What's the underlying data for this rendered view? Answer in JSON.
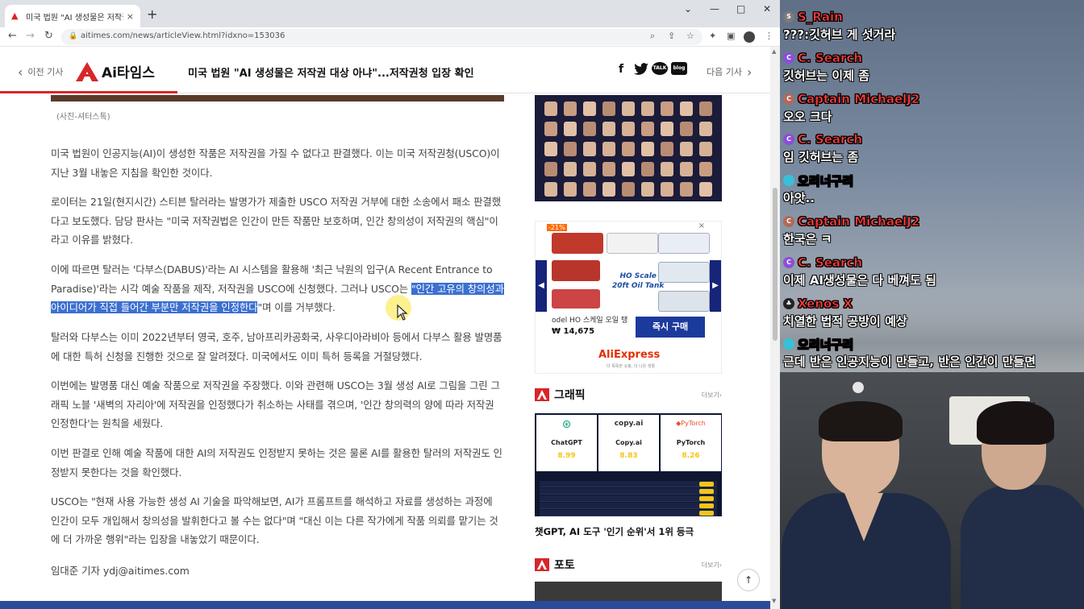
{
  "browser": {
    "tab_title": "미국 법원 \"AI 생성물은 저작권 대상 아니\"...",
    "tab_close": "×",
    "new_tab": "+",
    "url": "aitimes.com/news/articleView.html?idxno=153036",
    "window_controls": {
      "chevron": "⌄",
      "minimize": "—",
      "maximize": "□",
      "close": "✕"
    }
  },
  "site": {
    "prev_label": "이전 기사",
    "logo_text": "Ai타임스",
    "headline": "미국 법원 \"AI 생성물은 저작권 대상 아냐\"...저작권청 입장 확인",
    "social": [
      "f",
      "🐦",
      "TALK",
      "blog"
    ],
    "next_label": "다음 기사"
  },
  "article": {
    "caption": "(사진-셔터스톡)",
    "paragraphs": [
      {
        "text": "미국 법원이 인공지능(AI)이 생성한 작품은 저작권을 가질 수 없다고 판결했다. 이는 미국 저작권청(USCO)이 지난 3월 내놓은 지침을 확인한 것이다."
      },
      {
        "text": "로이터는 21일(현지시간) 스티븐 탈러라는 발명가가 제출한 USCO 저작권 거부에 대한 소송에서 패소 판결했다고 보도했다. 담당 판사는 \"미국 저작권법은 인간이 만든 작품만 보호하며, 인간 창의성이 저작권의 핵심\"이라고 이유를 밝혔다."
      },
      {
        "before": "이에 따르면 탈러는 '다부스(DABUS)'라는 AI 시스템을 활용해 '최근 낙원의 입구(A Recent Entrance to Paradise)'라는 시각 예술 작품을 제작, 저작권을 USCO에 신청했다. 그러나 USCO는 ",
        "highlight": "\"인간 고유의 창의성과 아이디어가 직접 들어간 부분만 저작권을 인정한다",
        "after": "\"며 이를 거부했다."
      },
      {
        "text": "탈러와 다부스는 이미 2022년부터 영국, 호주, 남아프리카공화국, 사우디아라비아 등에서 다부스 활용 발명품에 대한 특허 신청을 진행한 것으로 잘 알려졌다. 미국에서도 이미 특허 등록을 거절당했다."
      },
      {
        "text": "이번에는 발명품 대신 예술 작품으로 저작권을 주장했다. 이와 관련해 USCO는 3월 생성 AI로 그림을 그린 그래픽 노블 '새벽의 자리아'에 저작권을 인정했다가 취소하는 사태를 겪으며, '인간 창의력의 양에 따라 저작권 인정한다'는 원칙을 세웠다."
      },
      {
        "text": "이번 판결로 인해 예술 작품에 대한 AI의 저작권도 인정받지 못하는 것은 물론 AI를 활용한 탈러의 저작권도 인정받지 못한다는 것을 확인했다."
      },
      {
        "text": "USCO는 \"현재 사용 가능한 생성 AI 기술을 파악해보면, AI가 프롬프트를 해석하고 자료를 생성하는 과정에 인간이 모두 개입해서 창의성을 발휘한다고 볼 수는 없다\"며 \"대신 이는 다른 작가에게 작품 의뢰를 맡기는 것에 더 가까운 행위\"라는 입장을 내놓았기 때문이다."
      }
    ],
    "byline": "임대준 기자 ydj@aitimes.com"
  },
  "sidebar": {
    "ad": {
      "sale": "-21%",
      "scale_line1": "HO Scale",
      "scale_line2": "20ft Oil Tank",
      "product": "odel HO 스케일 오일 탱",
      "price": "₩ 14,675",
      "buy": "즉시 구매",
      "brand": "AliExpress",
      "brand_sub": "더 똑똑한 쇼핑, 더 나은 생활",
      "close": "×"
    },
    "graphic": {
      "title": "그래픽",
      "more": "더보기›",
      "cards": [
        {
          "logo": "⊛",
          "name": "ChatGPT",
          "score": "8.99"
        },
        {
          "logo": "copy.ai",
          "name": "Copy.ai",
          "score": "8.83"
        },
        {
          "logo": "◆PyTorch",
          "name": "PyTorch",
          "score": "8.26"
        }
      ],
      "caption": "챗GPT, AI 도구 '인기 순위'서 1위 등극"
    },
    "photo": {
      "title": "포토",
      "more": "더보기›"
    },
    "to_top": "↑"
  },
  "chat": [
    {
      "name": "S_Rain",
      "color": "#ff3b3b",
      "badge": "S",
      "badge_color": "#7a7a7a",
      "msg": "???:깃허브 게 섯거라"
    },
    {
      "name": "C. Search",
      "color": "#ff3b3b",
      "badge": "C",
      "badge_color": "#8a4fd8",
      "msg": "깃허브는 이제 좀"
    },
    {
      "name": "Captain MichaelJ2",
      "color": "#ff3b3b",
      "badge": "C",
      "badge_color": "#b06a5a",
      "msg": "오오 크다"
    },
    {
      "name": "C. Search",
      "color": "#ff3b3b",
      "badge": "C",
      "badge_color": "#8a4fd8",
      "msg": "임 깃허브는 좀"
    },
    {
      "name": "오리너구리",
      "color": "#ff3b3b",
      "badge": "",
      "badge_color": "#37c0d8",
      "msg": "아앗.."
    },
    {
      "name": "Captain MichaelJ2",
      "color": "#ff3b3b",
      "badge": "C",
      "badge_color": "#b06a5a",
      "msg": "한국은 ㅋ"
    },
    {
      "name": "C. Search",
      "color": "#ff3b3b",
      "badge": "C",
      "badge_color": "#8a4fd8",
      "msg": "이제 AI생성물은 다 베껴도 됨"
    },
    {
      "name": "Xenos X",
      "color": "#ff3b3b",
      "badge": "♣",
      "badge_color": "#222222",
      "msg": "치열한 법적 공방이 예상"
    },
    {
      "name": "오리너구리",
      "color": "#ff3b3b",
      "badge": "",
      "badge_color": "#37c0d8",
      "msg": "근데 반은 인공지능이 만들고, 반은 인간이 만들면"
    }
  ]
}
